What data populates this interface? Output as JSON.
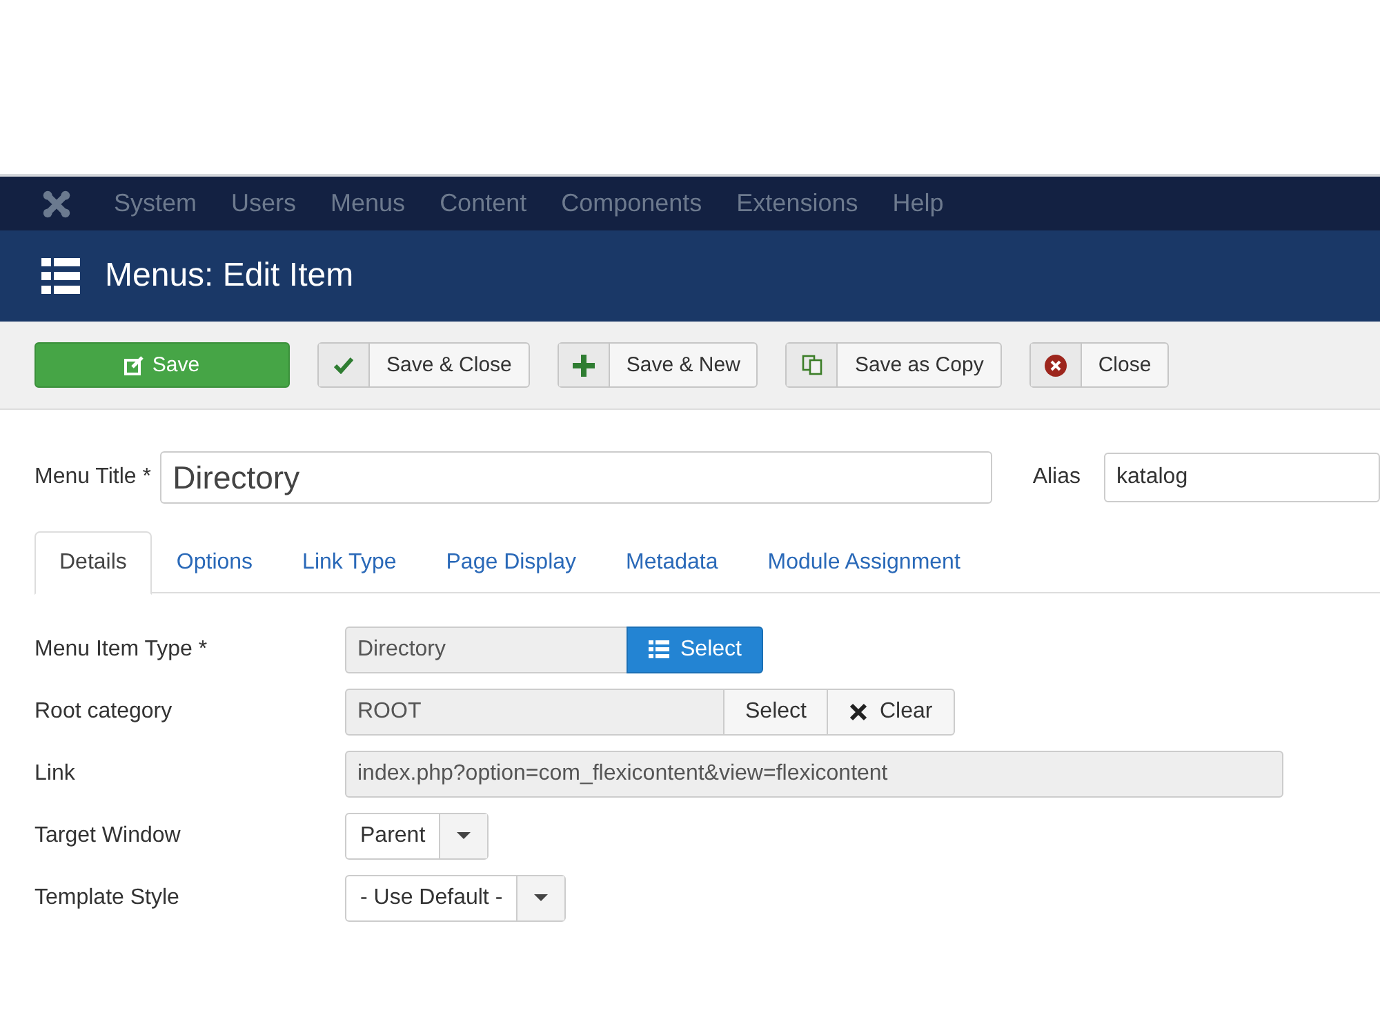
{
  "nav": {
    "items": [
      "System",
      "Users",
      "Menus",
      "Content",
      "Components",
      "Extensions",
      "Help"
    ]
  },
  "header": {
    "title": "Menus: Edit Item"
  },
  "toolbar": [
    {
      "label": "Save",
      "kind": "primary"
    },
    {
      "label": "Save & Close",
      "kind": "apply"
    },
    {
      "label": "Save & New",
      "kind": "new"
    },
    {
      "label": "Save as Copy",
      "kind": "copy"
    },
    {
      "label": "Close",
      "kind": "cancel"
    }
  ],
  "title_field": {
    "label": "Menu Title *",
    "value": "Directory"
  },
  "alias_field": {
    "label": "Alias",
    "value": "katalog"
  },
  "tabs": [
    {
      "label": "Details",
      "selected": true
    },
    {
      "label": "Options",
      "selected": false
    },
    {
      "label": "Link Type",
      "selected": false
    },
    {
      "label": "Page Display",
      "selected": false
    },
    {
      "label": "Metadata",
      "selected": false
    },
    {
      "label": "Module Assignment",
      "selected": false
    }
  ],
  "fields": [
    {
      "label": "Menu Item Type *",
      "kind": "modal",
      "value": "Directory",
      "buttons": [
        {
          "label": "Select",
          "kind": "primary"
        }
      ]
    },
    {
      "label": "Root category",
      "kind": "modal",
      "value": "ROOT",
      "buttons": [
        {
          "label": "Select",
          "kind": "plain"
        },
        {
          "label": "Clear",
          "kind": "clear"
        }
      ]
    },
    {
      "label": "Link",
      "kind": "readonly",
      "value": "index.php?option=com_flexicontent&view=flexicontent"
    },
    {
      "label": "Target Window",
      "kind": "select",
      "value": "Parent"
    },
    {
      "label": "Template Style",
      "kind": "select",
      "value": "- Use Default -"
    }
  ]
}
